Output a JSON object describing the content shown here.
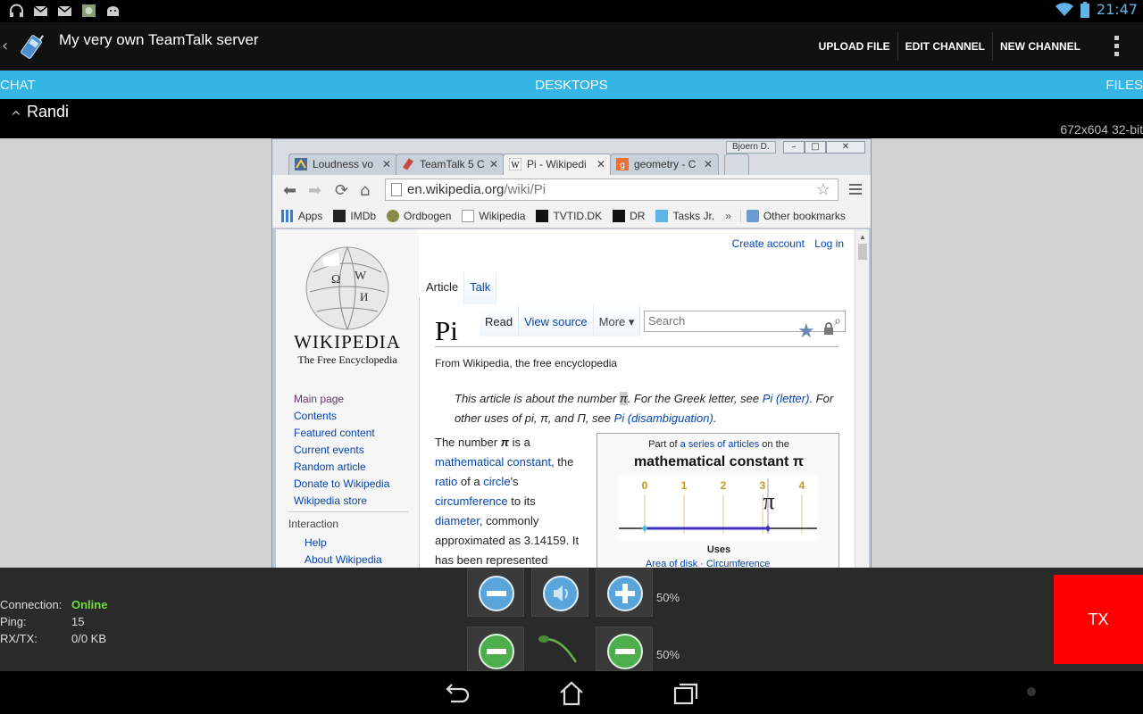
{
  "status_bar": {
    "time": "21:47"
  },
  "action_bar": {
    "title": "My very own TeamTalk server",
    "actions": [
      "UPLOAD FILE",
      "EDIT CHANNEL",
      "NEW CHANNEL"
    ]
  },
  "tabs": {
    "left": "CHAT",
    "center": "DESKTOPS",
    "right": "FILES"
  },
  "desktop": {
    "user": "Randi",
    "resolution": "672x604 32-bit",
    "window_user_badge": "Bjoern D.",
    "browser_tabs": [
      "Loudness vo",
      "TeamTalk 5 C",
      "Pi - Wikipedi",
      "geometry - C"
    ],
    "url_host": "en.wikipedia.org",
    "url_path": "/wiki/Pi",
    "bookmarks": [
      "Apps",
      "IMDb",
      "Ordbogen",
      "Wikipedia",
      "TVTID.DK",
      "DR",
      "Tasks Jr."
    ],
    "bookmarks_more": "»",
    "bookmarks_other": "Other bookmarks",
    "page": {
      "wordmark": "WIKIPEDIA",
      "tagline": "The Free Encyclopedia",
      "nav": [
        "Main page",
        "Contents",
        "Featured content",
        "Current events",
        "Random article",
        "Donate to Wikipedia",
        "Wikipedia store"
      ],
      "interaction_header": "Interaction",
      "interaction": [
        "Help",
        "About Wikipedia"
      ],
      "personal": [
        "Create account",
        "Log in"
      ],
      "ns_tabs": [
        "Article",
        "Talk"
      ],
      "view_tabs": [
        "Read",
        "View source",
        "More"
      ],
      "search_placeholder": "Search",
      "title": "Pi",
      "from": "From Wikipedia, the free encyclopedia",
      "hatnote": {
        "t1": "This article is about the number ",
        "sym": "π",
        "t2": ". For the Greek letter, see ",
        "l1": "Pi (letter)",
        "t3": ". For other uses of pi, π, and Π, see ",
        "l2": "Pi (disambiguation)",
        "t4": "."
      },
      "para": {
        "t1": "The number ",
        "sym": "π",
        "t2": " is a ",
        "l1": "mathematical constant",
        "t3": ", the ",
        "l2": "ratio",
        "t4": " of a ",
        "l3": "circle",
        "t5": "'s ",
        "l4": "circumference",
        "t6": " to its ",
        "l5": "diameter",
        "t7": ", commonly approximated as 3.14159. It has been represented"
      },
      "infobox": {
        "part_prefix": "Part of ",
        "part_link": "a series of articles",
        "part_suffix": " on the",
        "title": "mathematical constant π",
        "ticks": [
          "0",
          "1",
          "2",
          "3",
          "4"
        ],
        "pi_symbol": "π",
        "uses": "Uses",
        "uses_links": "Area of disk · Circumference"
      }
    }
  },
  "connection": {
    "label": "Connection:",
    "status": "Online",
    "ping_label": "Ping:",
    "ping": "15",
    "rxtx_label": "RX/TX:",
    "rxtx": "0/0 KB"
  },
  "volume": {
    "output_percent": "50%",
    "input_percent": "50%"
  },
  "tx_label": "TX"
}
